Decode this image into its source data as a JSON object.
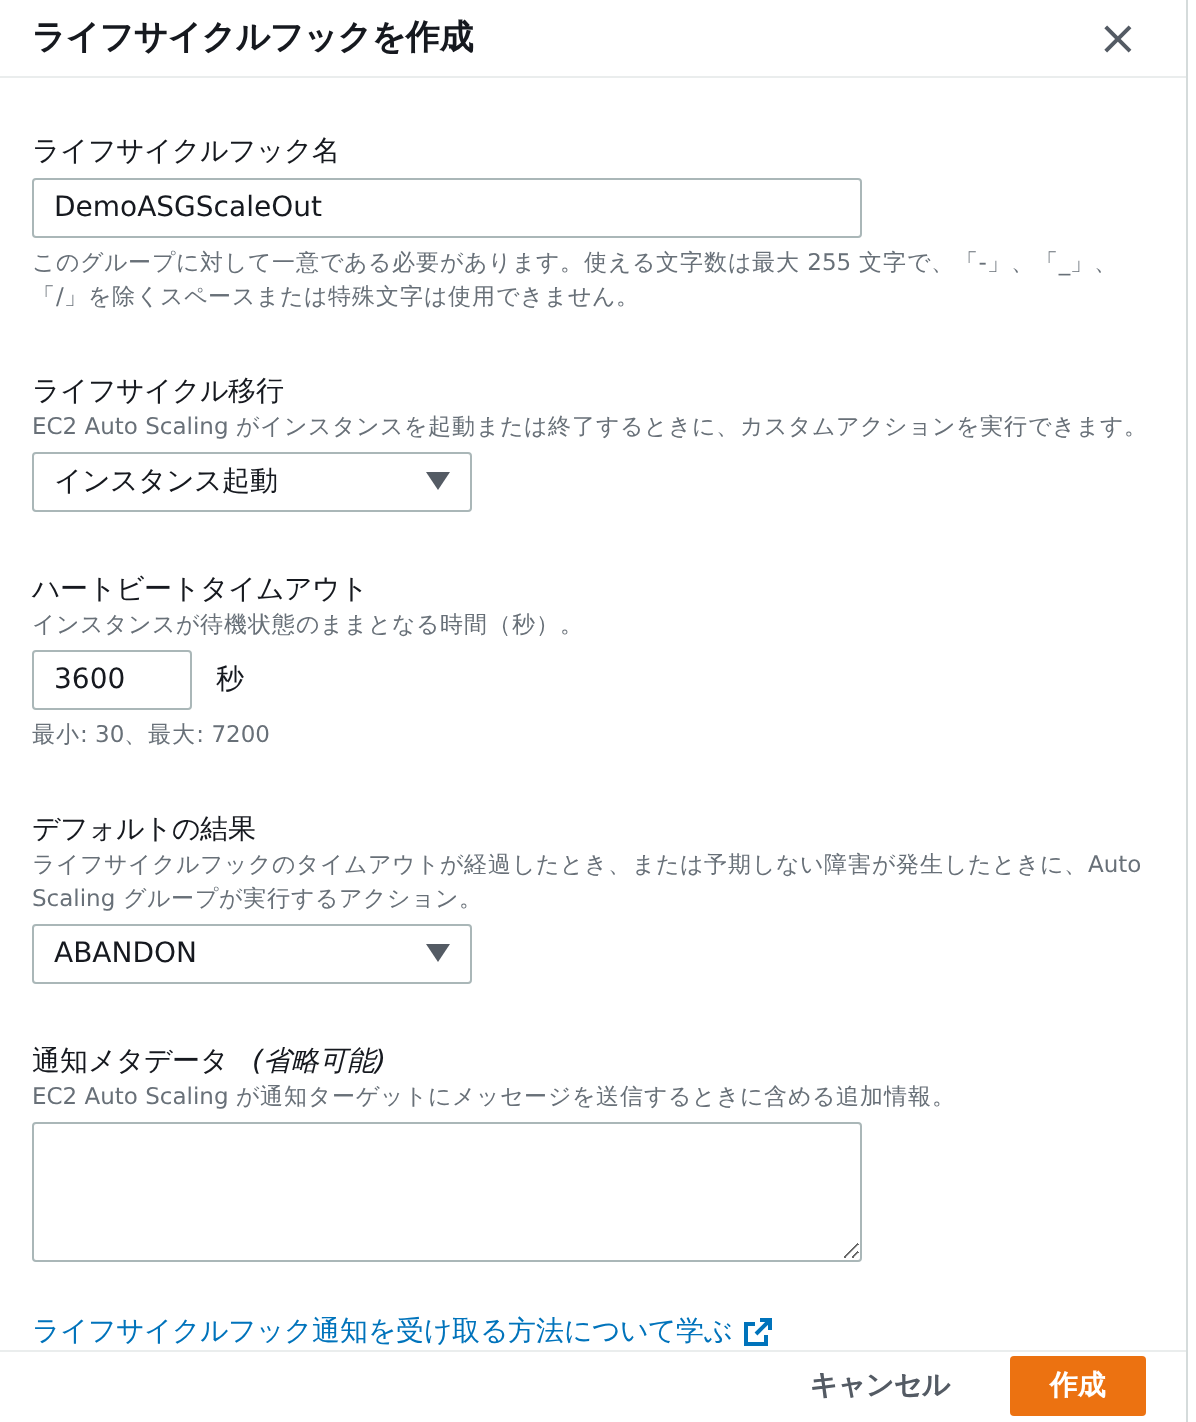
{
  "dialog": {
    "title": "ライフサイクルフックを作成",
    "close": "×"
  },
  "fields": [
    {
      "kind": "text",
      "label": "ライフサイクルフック名",
      "value": "DemoASGScaleOut",
      "description_below": "このグループに対して一意である必要があります。使える文字数は最大 255 文字で、「-」、「_」、「/」を除くスペースまたは特殊文字は使用できません。"
    },
    {
      "kind": "select",
      "label": "ライフサイクル移行",
      "description": "EC2 Auto Scaling がインスタンスを起動または終了するときに、カスタムアクションを実行できます。",
      "value": "インスタンス起動"
    },
    {
      "kind": "number",
      "label": "ハートビートタイムアウト",
      "description": "インスタンスが待機状態のままとなる時間（秒）。",
      "value": "3600",
      "unit": "秒",
      "description_below": "最小: 30、最大: 7200"
    },
    {
      "kind": "select",
      "label": "デフォルトの結果",
      "description": "ライフサイクルフックのタイムアウトが経過したとき、または予期しない障害が発生したときに、Auto Scaling グループが実行するアクション。",
      "value": "ABANDON"
    },
    {
      "kind": "textarea",
      "label": "通知メタデータ",
      "optional": "(省略可能)",
      "description": "EC2 Auto Scaling が通知ターゲットにメッセージを送信するときに含める追加情報。"
    }
  ],
  "link": "ライフサイクルフック通知を受け取る方法について学ぶ",
  "buttons": [
    {
      "kind": "secondary",
      "label": "キャンセル"
    },
    {
      "kind": "primary",
      "label": "作成"
    }
  ]
}
